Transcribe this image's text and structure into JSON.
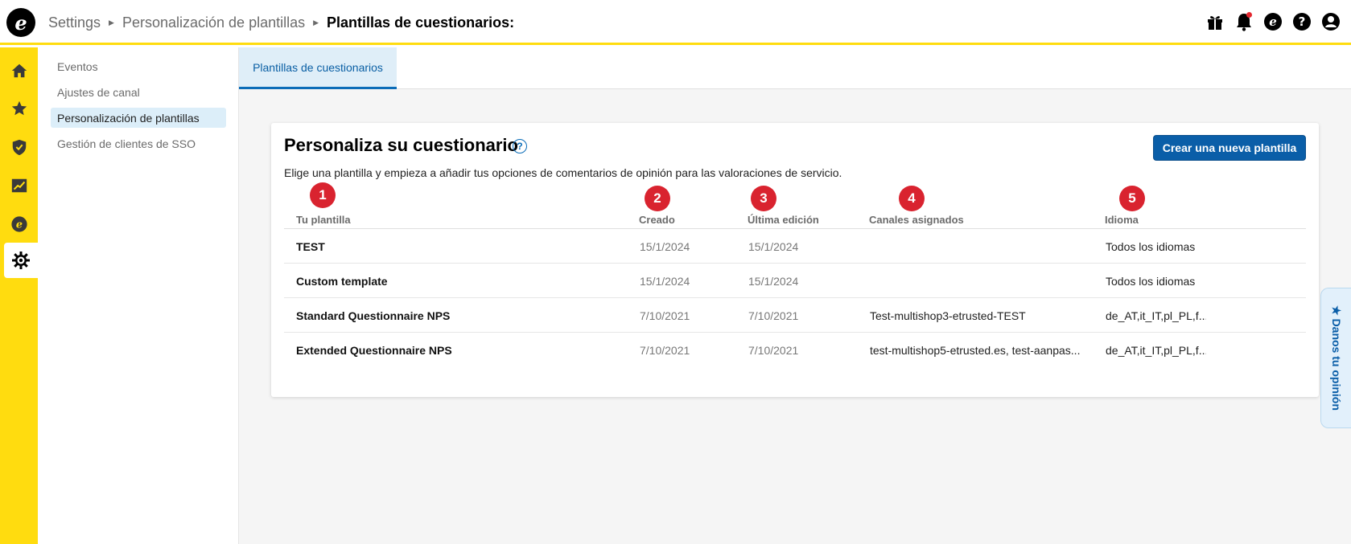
{
  "header": {
    "logo_letter": "e",
    "breadcrumb": [
      {
        "label": "Settings"
      },
      {
        "label": "Personalización de plantillas"
      }
    ],
    "current": "Plantillas de cuestionarios:",
    "icons": [
      "gift-icon",
      "bell-icon",
      "etrusted-icon",
      "help-icon",
      "user-icon"
    ]
  },
  "rail": {
    "items": [
      "home-icon",
      "star-icon",
      "shield-icon",
      "chart-icon",
      "etrusted-icon",
      "gear-icon"
    ],
    "active": "gear-icon"
  },
  "subnav": {
    "items": [
      {
        "label": "Eventos"
      },
      {
        "label": "Ajustes de canal"
      },
      {
        "label": "Personalización de plantillas"
      },
      {
        "label": "Gestión de clientes de SSO"
      }
    ],
    "active_index": 2
  },
  "tabs": [
    {
      "label": "Plantillas de cuestionarios"
    }
  ],
  "card": {
    "title": "Personaliza su cuestionario",
    "help_symbol": "?",
    "description": "Elige una plantilla y empieza a añadir tus opciones de comentarios de opinión para las valoraciones de servicio.",
    "create_button": "Crear una nueva plantilla"
  },
  "table": {
    "columns": [
      {
        "label": "Tu plantilla",
        "badge": "1"
      },
      {
        "label": "Creado",
        "badge": "2"
      },
      {
        "label": "Última edición",
        "badge": "3"
      },
      {
        "label": "Canales asignados",
        "badge": "4"
      },
      {
        "label": "Idioma",
        "badge": "5"
      }
    ],
    "rows": [
      {
        "name": "TEST",
        "created": "15/1/2024",
        "edited": "15/1/2024",
        "channels": "",
        "language": "Todos los idiomas"
      },
      {
        "name": "Custom template",
        "created": "15/1/2024",
        "edited": "15/1/2024",
        "channels": "",
        "language": "Todos los idiomas"
      },
      {
        "name": "Standard Questionnaire NPS",
        "created": "7/10/2021",
        "edited": "7/10/2021",
        "channels": "Test-multishop3-etrusted-TEST",
        "language": "de_AT,it_IT,pl_PL,f..."
      },
      {
        "name": "Extended Questionnaire NPS",
        "created": "7/10/2021",
        "edited": "7/10/2021",
        "channels": "test-multishop5-etrusted.es, test-aanpas...",
        "language": "de_AT,it_IT,pl_PL,f..."
      }
    ]
  },
  "feedback": {
    "label": "★ Danos tu opinión"
  },
  "colors": {
    "accent_yellow": "#ffdc0f",
    "primary_blue": "#0a5ea8",
    "badge_red": "#d9232f"
  }
}
